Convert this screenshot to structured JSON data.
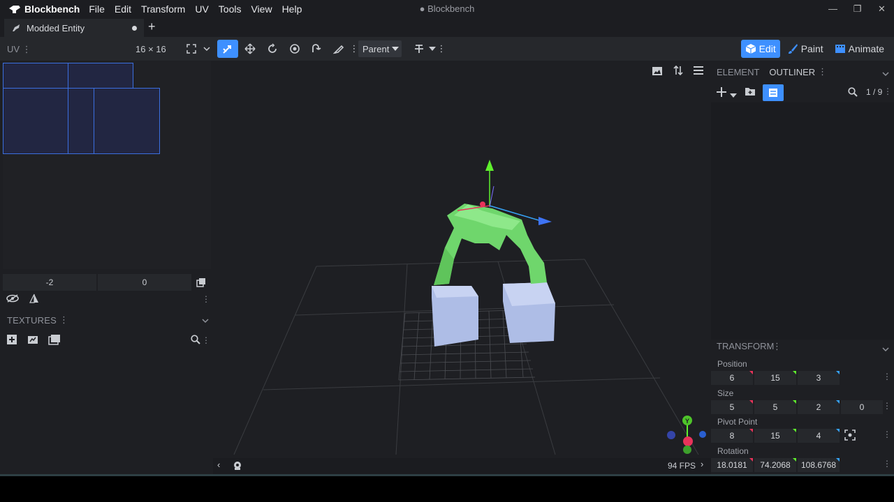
{
  "app": {
    "name": "Blockbench",
    "window_title": "● Blockbench",
    "menu": [
      "File",
      "Edit",
      "Transform",
      "UV",
      "Tools",
      "View",
      "Help"
    ]
  },
  "tabs": [
    {
      "label": "Modded Entity"
    }
  ],
  "toolbar": {
    "uv_label": "UV",
    "uv_resolution": "16 × 16",
    "pivot_mode": "Parent",
    "modes": [
      "Edit",
      "Paint",
      "Animate"
    ]
  },
  "uv_panel": {
    "inputs": [
      "-2",
      "0"
    ]
  },
  "textures_panel": {
    "title": "TEXTURES"
  },
  "viewport": {
    "fps": "94 FPS",
    "gizmo": {
      "y_label": "Y"
    }
  },
  "right_panel": {
    "tabs": [
      "ELEMENT",
      "OUTLINER"
    ],
    "outliner_count": "1 / 9",
    "transform_title": "TRANSFORM",
    "position_label": "Position",
    "position": [
      "6",
      "15",
      "3"
    ],
    "size_label": "Size",
    "size": [
      "5",
      "5",
      "2",
      "0"
    ],
    "pivot_label": "Pivot Point",
    "pivot": [
      "8",
      "15",
      "4"
    ],
    "rotation_label": "Rotation",
    "rotation": [
      "18.0181",
      "74.2068",
      "108.6768"
    ]
  },
  "colors": {
    "accent": "#3e90ff",
    "axis_x": "#e8335a",
    "axis_y": "#5ff02d",
    "axis_z": "#36a2f5",
    "model_green": "#6fd66c",
    "model_block": "#aebde6"
  }
}
